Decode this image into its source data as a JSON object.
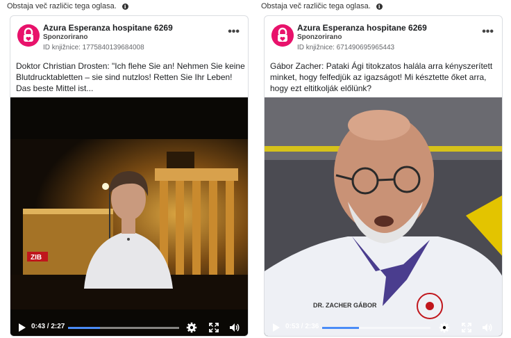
{
  "notice": "Obstaja več različic tega oglasa.",
  "ads": [
    {
      "page_name": "Azura Esperanza hospitane 6269",
      "sponsored": "Sponzorirano",
      "library_id": "ID knjižnice: 1775840139684008",
      "text": "Doktor Christian Drosten: \"Ich flehe Sie an! Nehmen Sie keine Blutdrucktabletten – sie sind nutzlos! Retten Sie Ihr Leben! Das beste Mittel ist...",
      "video_label": "ZIB",
      "time": "0:43 / 2:27",
      "progress": 0.29
    },
    {
      "page_name": "Azura Esperanza hospitane 6269",
      "sponsored": "Sponzorirano",
      "library_id": "ID knjižnice: 671490695965443",
      "text": "Gábor Zacher: Pataki Ági titokzatos halála arra kényszerített minket, hogy felfedjük az igazságot! Mi késztette őket arra, hogy ezt eltitkolják előlünk?",
      "video_label": "DR. ZACHER GÁBOR",
      "time": "0:53 / 2:36",
      "progress": 0.34
    }
  ],
  "colors": {
    "brand": "#e8126b",
    "progress": "#4a8cf7"
  },
  "icons": [
    "info-icon",
    "more-options-icon",
    "play-icon",
    "settings-icon",
    "fullscreen-icon",
    "volume-icon"
  ]
}
